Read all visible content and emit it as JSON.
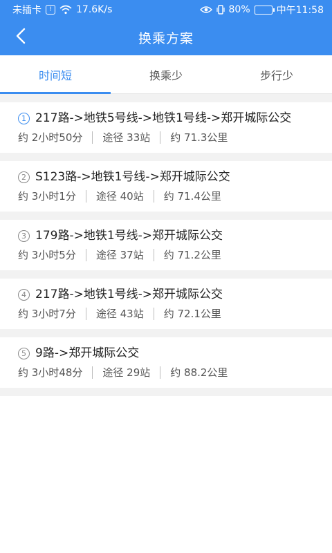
{
  "status_bar": {
    "carrier": "未插卡",
    "speed": "17.6K/s",
    "battery": "80%",
    "time": "中午11:58",
    "battery_level": 0.8
  },
  "header": {
    "title": "换乘方案",
    "back_icon": "chevron-left-icon"
  },
  "tabs": [
    {
      "label": "时间短",
      "active": true
    },
    {
      "label": "换乘少",
      "active": false
    },
    {
      "label": "步行少",
      "active": false
    }
  ],
  "routes": [
    {
      "index": "1",
      "title": "217路->地铁5号线->地铁1号线->郑开城际公交",
      "duration": "约 2小时50分",
      "stops": "途径 33站",
      "distance": "约 71.3公里"
    },
    {
      "index": "2",
      "title": "S123路->地铁1号线->郑开城际公交",
      "duration": "约 3小时1分",
      "stops": "途径 40站",
      "distance": "约 71.4公里"
    },
    {
      "index": "3",
      "title": "179路->地铁1号线->郑开城际公交",
      "duration": "约 3小时5分",
      "stops": "途径 37站",
      "distance": "约 71.2公里"
    },
    {
      "index": "4",
      "title": "217路->地铁1号线->郑开城际公交",
      "duration": "约 3小时7分",
      "stops": "途径 43站",
      "distance": "约 72.1公里"
    },
    {
      "index": "5",
      "title": "9路->郑开城际公交",
      "duration": "约 3小时48分",
      "stops": "途径 29站",
      "distance": "约 88.2公里"
    }
  ],
  "colors": {
    "accent": "#3b8df0"
  }
}
